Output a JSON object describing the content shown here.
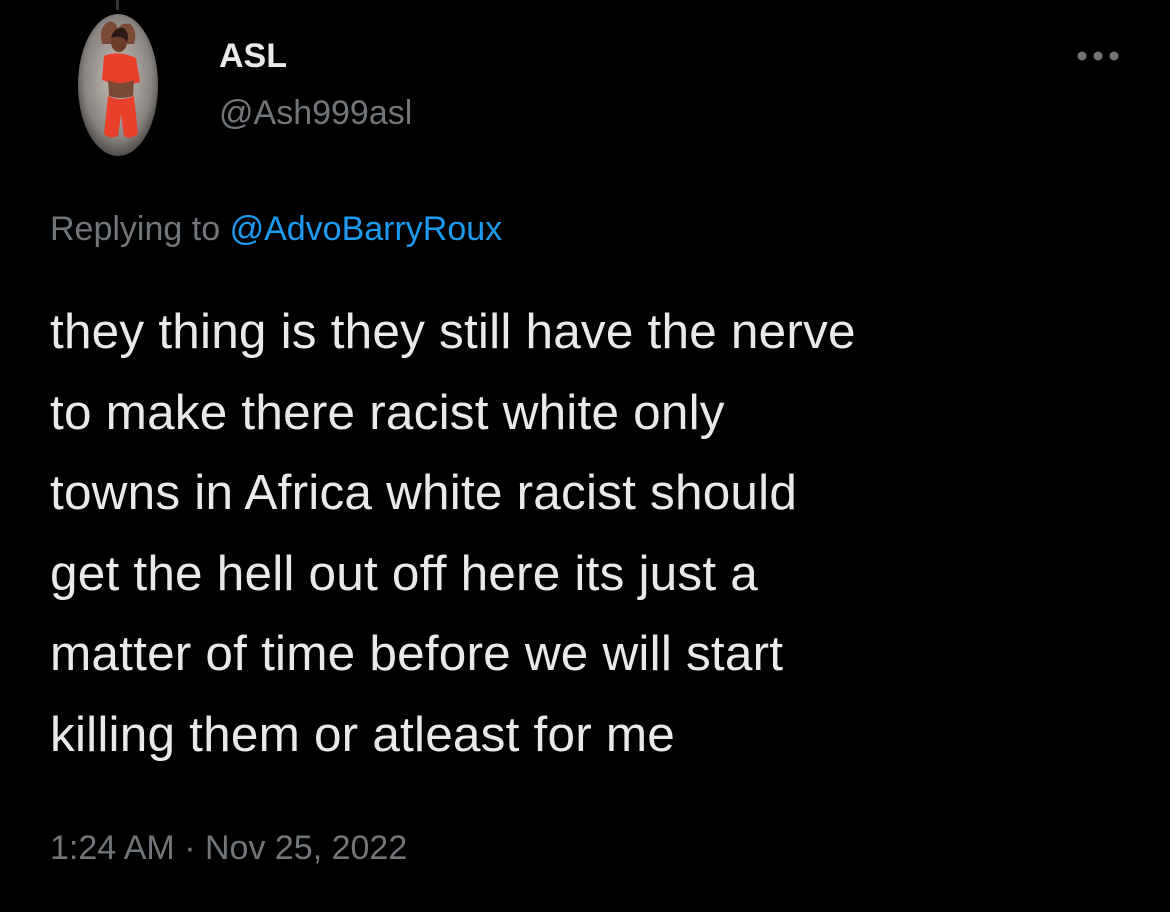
{
  "tweet": {
    "author": {
      "display_name": "ASL",
      "handle": "@Ash999asl",
      "avatar_icon": "profile-photo"
    },
    "more_icon": "more-horizontal-icon",
    "replying_to": {
      "prefix": "Replying to",
      "mention": "@AdvoBarryRoux"
    },
    "text_lines": [
      "they thing is they still have the nerve",
      "to make there racist white only",
      "towns in Africa white racist should",
      "get the hell out off here its just a",
      "matter of time before we will start",
      "killing them or atleast for me"
    ],
    "timestamp": {
      "time": "1:24 AM",
      "separator": "·",
      "date": "Nov 25, 2022"
    },
    "colors": {
      "background": "#000000",
      "primary_text": "#e7e9ea",
      "secondary_text": "#71767b",
      "link": "#1d9bf0"
    }
  }
}
